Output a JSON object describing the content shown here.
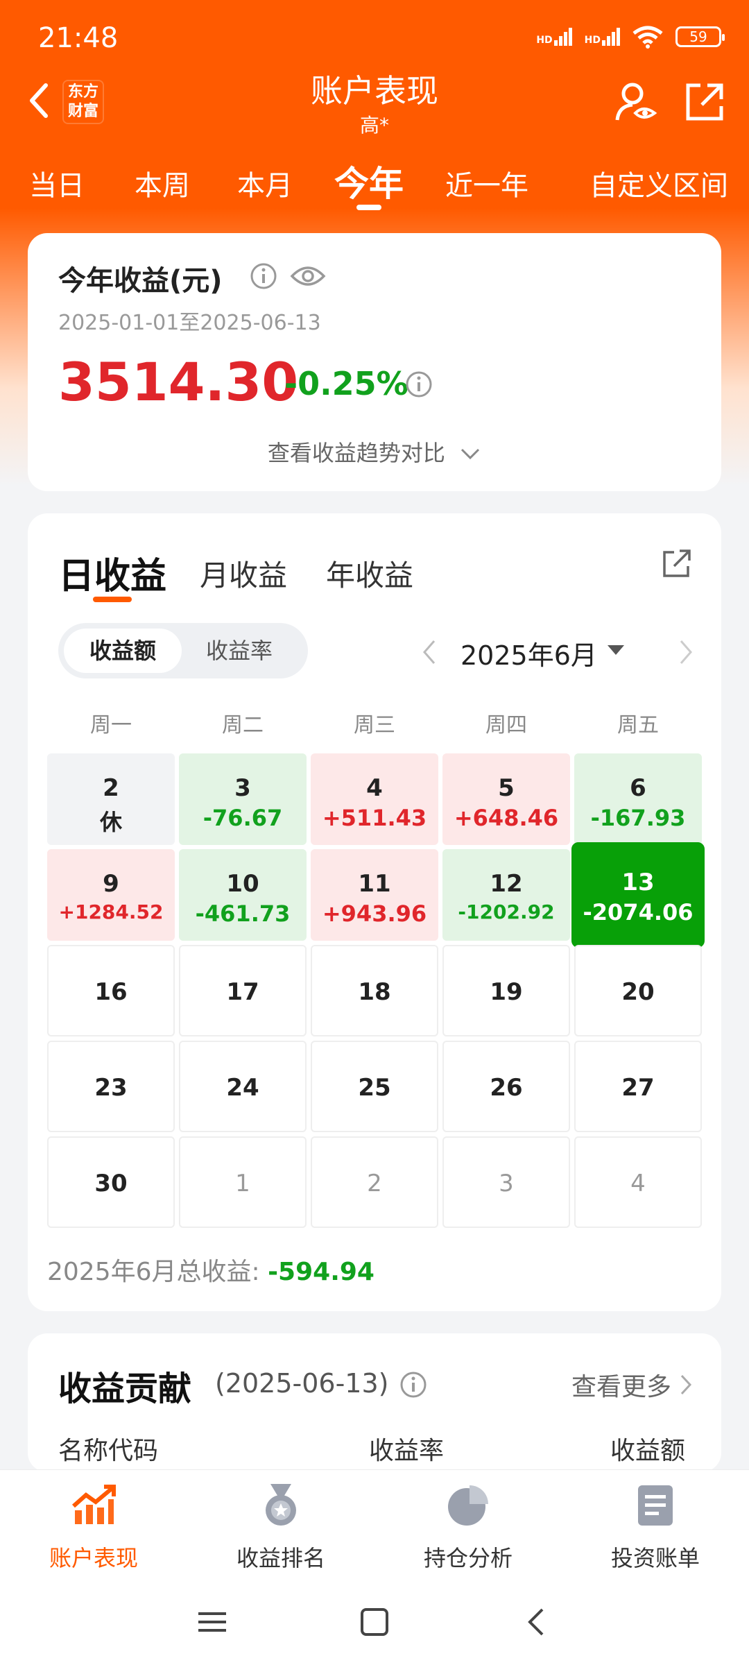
{
  "status": {
    "time": "21:48",
    "battery": "59",
    "network1": "HD",
    "network2": "HD"
  },
  "header": {
    "title": "账户表现",
    "subtitle": "高*",
    "logo_line1": "东方",
    "logo_line2": "财富"
  },
  "periods": [
    "当日",
    "本周",
    "本月",
    "今年",
    "近一年",
    "自定义区间"
  ],
  "active_period": "今年",
  "summary": {
    "title": "今年收益(元)",
    "range": "2025-01-01至2025-06-13",
    "amount": "3514.30",
    "percent": "-0.25%",
    "trend_link": "查看收益趋势对比"
  },
  "returns": {
    "tabs": [
      "日收益",
      "月收益",
      "年收益"
    ],
    "segment": [
      "收益额",
      "收益率"
    ],
    "month_label": "2025年6月",
    "weekdays": [
      "周一",
      "周二",
      "周三",
      "周四",
      "周五"
    ],
    "weeks": [
      [
        {
          "d": "2",
          "v": "休",
          "type": "rest"
        },
        {
          "d": "3",
          "v": "-76.67",
          "type": "loss"
        },
        {
          "d": "4",
          "v": "+511.43",
          "type": "gain"
        },
        {
          "d": "5",
          "v": "+648.46",
          "type": "gain"
        },
        {
          "d": "6",
          "v": "-167.93",
          "type": "loss"
        }
      ],
      [
        {
          "d": "9",
          "v": "+1284.52",
          "type": "gain",
          "small": true
        },
        {
          "d": "10",
          "v": "-461.73",
          "type": "loss"
        },
        {
          "d": "11",
          "v": "+943.96",
          "type": "gain"
        },
        {
          "d": "12",
          "v": "-1202.92",
          "type": "loss",
          "small": true
        },
        {
          "d": "13",
          "v": "-2074.06",
          "type": "sel"
        }
      ],
      [
        {
          "d": "16"
        },
        {
          "d": "17"
        },
        {
          "d": "18"
        },
        {
          "d": "19"
        },
        {
          "d": "20"
        }
      ],
      [
        {
          "d": "23"
        },
        {
          "d": "24"
        },
        {
          "d": "25"
        },
        {
          "d": "26"
        },
        {
          "d": "27"
        }
      ],
      [
        {
          "d": "30"
        },
        {
          "d": "1",
          "dim": true
        },
        {
          "d": "2",
          "dim": true
        },
        {
          "d": "3",
          "dim": true
        },
        {
          "d": "4",
          "dim": true
        }
      ]
    ],
    "total_label": "2025年6月总收益:",
    "total_value": "-594.94"
  },
  "contribution": {
    "title": "收益贡献",
    "date": "(2025-06-13)",
    "more": "查看更多",
    "col_name": "名称代码",
    "col_rate": "收益率",
    "col_amount": "收益额"
  },
  "bottom_nav": [
    "账户表现",
    "收益排名",
    "持仓分析",
    "投资账单"
  ],
  "colors": {
    "brand": "#ff5a00",
    "gain": "#e0262b",
    "loss": "#11a11d"
  }
}
